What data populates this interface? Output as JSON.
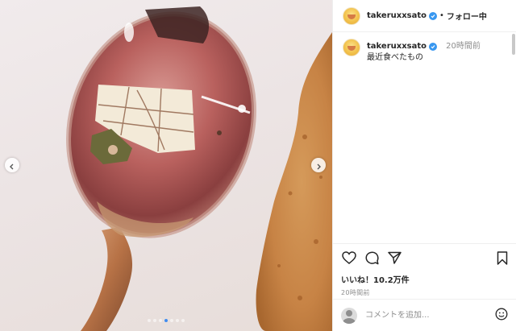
{
  "header": {
    "username": "takeruxxsato",
    "separator": "•",
    "follow_label": "フォロー中"
  },
  "caption": {
    "username": "takeruxxsato",
    "time_ago": "20時間前",
    "text": "最近食べたもの"
  },
  "actions": {
    "likes": "いいね！10.2万件",
    "timestamp": "20時間前"
  },
  "comment": {
    "placeholder": "コメントを追加..."
  },
  "carousel": {
    "slide_count": 7,
    "active_index": 3
  },
  "colors": {
    "verified": "#3897f0",
    "active_dot": "#3f8cf0"
  },
  "icons": [
    "chevron-left-icon",
    "chevron-right-icon",
    "verified-icon",
    "heart-icon",
    "comment-icon",
    "share-icon",
    "bookmark-icon",
    "smiley-icon"
  ]
}
